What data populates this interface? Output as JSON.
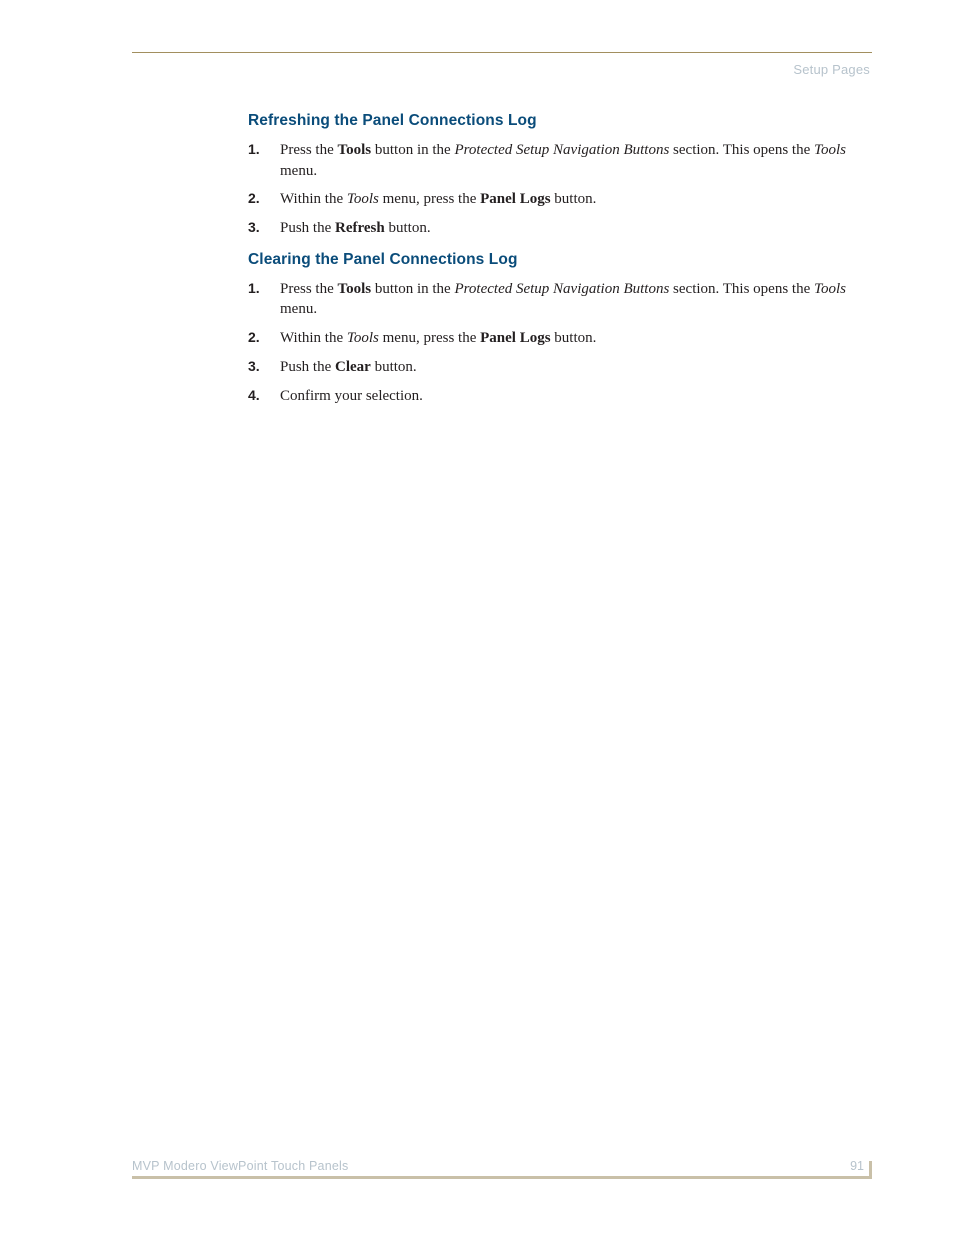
{
  "header": {
    "section_label": "Setup Pages"
  },
  "sections": [
    {
      "heading": "Refreshing the Panel Connections Log",
      "steps": [
        {
          "runs": [
            {
              "t": "Press the "
            },
            {
              "t": "Tools",
              "b": true
            },
            {
              "t": " button in the "
            },
            {
              "t": "Protected Setup Navigation Buttons",
              "i": true
            },
            {
              "t": " section. This opens the "
            },
            {
              "t": "Tools",
              "i": true
            },
            {
              "t": " menu."
            }
          ]
        },
        {
          "runs": [
            {
              "t": "Within the "
            },
            {
              "t": "Tools",
              "i": true
            },
            {
              "t": " menu, press the "
            },
            {
              "t": "Panel Logs",
              "b": true
            },
            {
              "t": " button."
            }
          ]
        },
        {
          "runs": [
            {
              "t": "Push the "
            },
            {
              "t": "Refresh",
              "b": true
            },
            {
              "t": " button."
            }
          ]
        }
      ]
    },
    {
      "heading": "Clearing the Panel Connections Log",
      "steps": [
        {
          "runs": [
            {
              "t": "Press the "
            },
            {
              "t": "Tools",
              "b": true
            },
            {
              "t": " button in the "
            },
            {
              "t": "Protected Setup Navigation Buttons",
              "i": true
            },
            {
              "t": " section. This opens the "
            },
            {
              "t": "Tools",
              "i": true
            },
            {
              "t": " menu."
            }
          ]
        },
        {
          "runs": [
            {
              "t": "Within the "
            },
            {
              "t": "Tools",
              "i": true
            },
            {
              "t": " menu, press the "
            },
            {
              "t": "Panel Logs",
              "b": true
            },
            {
              "t": " button."
            }
          ]
        },
        {
          "runs": [
            {
              "t": "Push the "
            },
            {
              "t": "Clear",
              "b": true
            },
            {
              "t": " button."
            }
          ]
        },
        {
          "runs": [
            {
              "t": "Confirm your selection."
            }
          ]
        }
      ]
    }
  ],
  "footer": {
    "doc_title": "MVP Modero ViewPoint Touch Panels",
    "page_number": "91"
  }
}
